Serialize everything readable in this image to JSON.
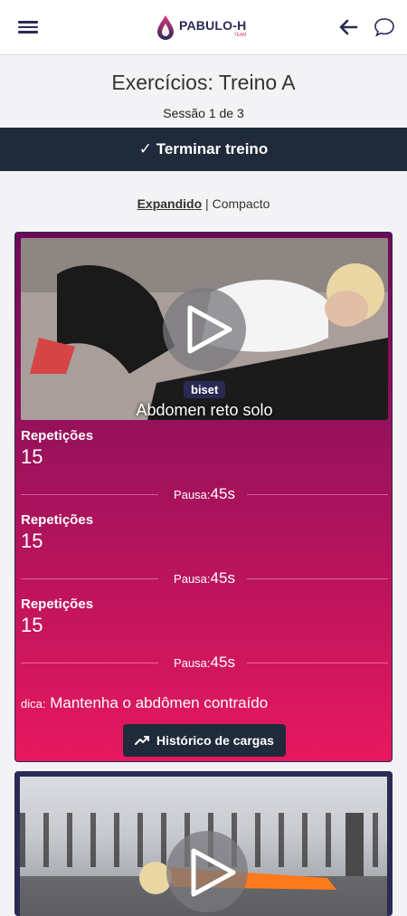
{
  "header": {
    "brand": "PABULO-H",
    "brand_sub": "TEAM"
  },
  "page": {
    "title": "Exercícios: Treino A",
    "session": "Sessão 1 de 3",
    "finish_label": "✓ Terminar treino"
  },
  "view_toggle": {
    "expanded": "Expandido",
    "separator": "|",
    "compact": "Compacto"
  },
  "exercise": {
    "badge": "biset",
    "name": "Abdomen reto solo",
    "sets": [
      {
        "label": "Repetições",
        "value": "15",
        "pause_label": "Pausa:",
        "pause_value": "45s"
      },
      {
        "label": "Repetições",
        "value": "15",
        "pause_label": "Pausa:",
        "pause_value": "45s"
      },
      {
        "label": "Repetições",
        "value": "15",
        "pause_label": "Pausa:",
        "pause_value": "45s"
      }
    ],
    "tip_label": "dica:",
    "tip_text": "Mantenha o abdômen contraído",
    "history_label": "Histórico de cargas"
  },
  "colors": {
    "navy": "#2a2a55",
    "dark_bar": "#1f2b3a",
    "gradient_top": "#6d0b57",
    "gradient_bottom": "#e8185e",
    "accent_pink": "#e8357a"
  },
  "icons": [
    "menu-icon",
    "logo-drop-icon",
    "arrow-left-icon",
    "chat-icon",
    "play-icon",
    "trend-up-icon"
  ]
}
